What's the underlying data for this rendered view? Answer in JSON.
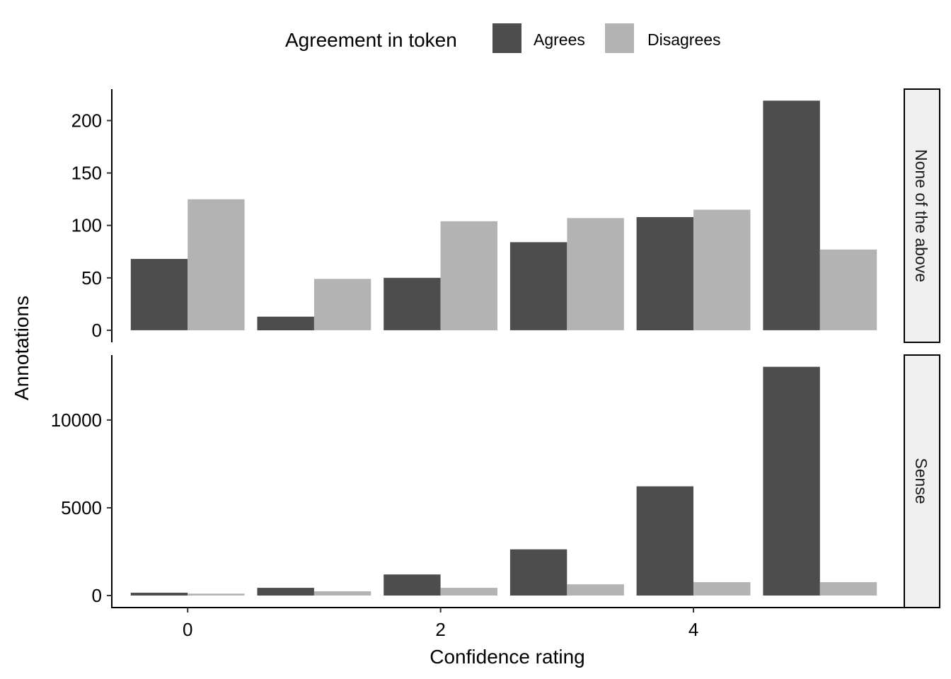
{
  "chart_data": {
    "type": "bar",
    "layout": "faceted-vertical",
    "xlabel": "Confidence rating",
    "ylabel": "Annotations",
    "categories": [
      0,
      1,
      2,
      3,
      4,
      5
    ],
    "x_ticks": [
      "0",
      "2",
      "4"
    ],
    "x_tick_values": [
      0,
      2,
      4
    ],
    "legend": {
      "title": "Agreement in token",
      "position": "top",
      "entries": [
        {
          "name": "Agrees",
          "color": "#4d4d4d"
        },
        {
          "name": "Disagrees",
          "color": "#b3b3b3"
        }
      ]
    },
    "grid": false,
    "panels": [
      {
        "strip": "None of the above",
        "ylim": [
          0,
          230
        ],
        "y_ticks": [
          0,
          50,
          100,
          150,
          200
        ],
        "y_tick_labels": [
          "0",
          "50",
          "100",
          "150",
          "200"
        ],
        "series": [
          {
            "name": "Agrees",
            "values": [
              68,
              13,
              50,
              84,
              108,
              219
            ]
          },
          {
            "name": "Disagrees",
            "values": [
              125,
              49,
              104,
              107,
              115,
              77
            ]
          }
        ]
      },
      {
        "strip": "Sense",
        "ylim": [
          0,
          13700
        ],
        "y_ticks": [
          0,
          5000,
          10000
        ],
        "y_tick_labels": [
          "0",
          "5000",
          "10000"
        ],
        "series": [
          {
            "name": "Agrees",
            "values": [
              160,
              440,
              1200,
              2630,
              6220,
              13030
            ]
          },
          {
            "name": "Disagrees",
            "values": [
              110,
              240,
              440,
              640,
              760,
              760
            ]
          }
        ]
      }
    ]
  }
}
